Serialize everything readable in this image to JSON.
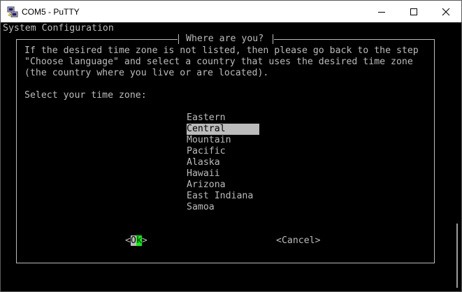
{
  "window": {
    "title": "COM5 - PuTTY",
    "app_icon": "putty-icon",
    "controls": [
      "minimize-icon",
      "maximize-icon",
      "close-icon"
    ]
  },
  "terminal": {
    "header": "System Configuration",
    "dialog": {
      "title": "Where are you?",
      "message_lines": [
        "If the desired time zone is not listed, then please go back to the step",
        "\"Choose language\" and select a country that uses the desired time zone",
        "(the country where you live or are located)."
      ],
      "prompt": "Select your time zone:",
      "options": [
        "Eastern",
        "Central",
        "Mountain",
        "Pacific",
        "Alaska",
        "Hawaii",
        "Arizona",
        "East Indiana",
        "Samoa"
      ],
      "selected_option": "Central",
      "ok_button": {
        "left": "<",
        "o": "O",
        "k": "k",
        "right": ">"
      },
      "cancel_button": "<Cancel>"
    }
  },
  "colors": {
    "terminal_bg": "#000000",
    "terminal_fg": "#bbbbbb",
    "focus_highlight": "#00ff00",
    "selection_bg": "#bbbbbb"
  }
}
